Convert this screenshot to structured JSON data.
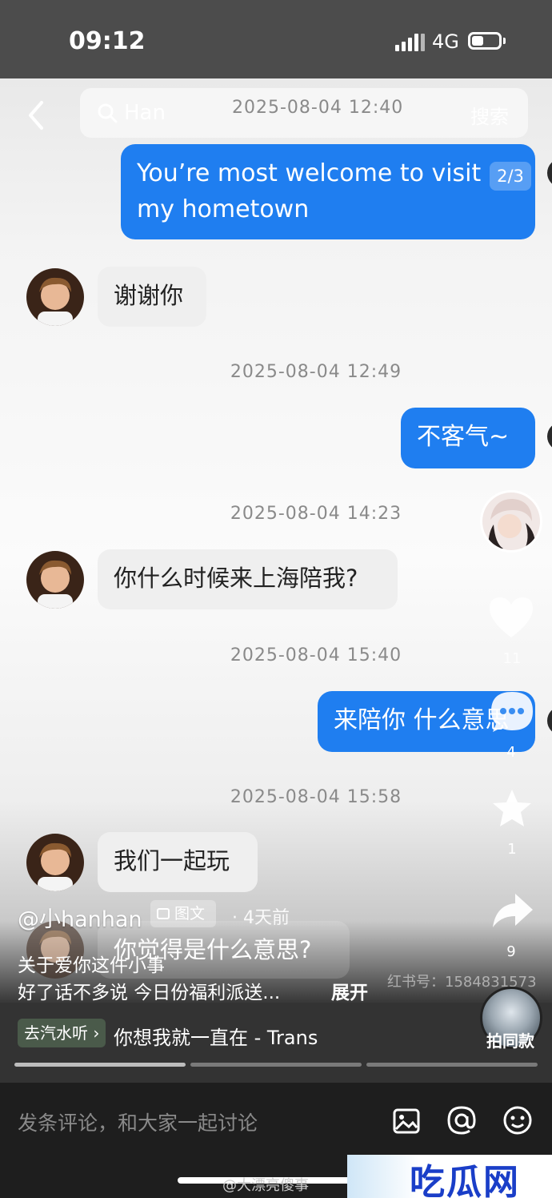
{
  "status_bar": {
    "time": "09:12",
    "network": "4G"
  },
  "header": {
    "search_text": "Han",
    "search_button": "搜索"
  },
  "pager": "2/3",
  "messages": {
    "ts1": "2025-08-04 12:40",
    "m1": "You’re most welcome to visit my hometown",
    "m2": "谢谢你",
    "ts2": "2025-08-04 12:49",
    "m3": "不客气~",
    "ts3": "2025-08-04 14:23",
    "m4": "你什么时候来上海陪我?",
    "ts4": "2025-08-04 15:40",
    "m5": "来陪你 什么意思",
    "ts5": "2025-08-04 15:58",
    "m6": "我们一起玩",
    "m7": "你觉得是什么意思?"
  },
  "side_actions": {
    "like_count": "11",
    "comment_count": "4",
    "star_count": "1",
    "share_count": "9"
  },
  "post": {
    "author": "@小hanhan",
    "tag": "图文",
    "time_ago": "· 4天前",
    "desc_line1": "关于爱你这件小事",
    "desc_line2": "好了话不多说 今日份福利派送...",
    "expand": "展开",
    "watermark": "红书号：1584831573"
  },
  "music": {
    "tag": "去汽水听 ›",
    "title": "你想我就一直在 - Trans",
    "make_same": "拍同款"
  },
  "comment_bar": {
    "placeholder": "发条评论，和大家一起讨论"
  },
  "footer": {
    "weibo": "@大漂亮傻事",
    "brand": "吃瓜网"
  },
  "colors": {
    "bubble_blue": "#1f7ef0",
    "brand_blue": "#1a3ec8"
  }
}
